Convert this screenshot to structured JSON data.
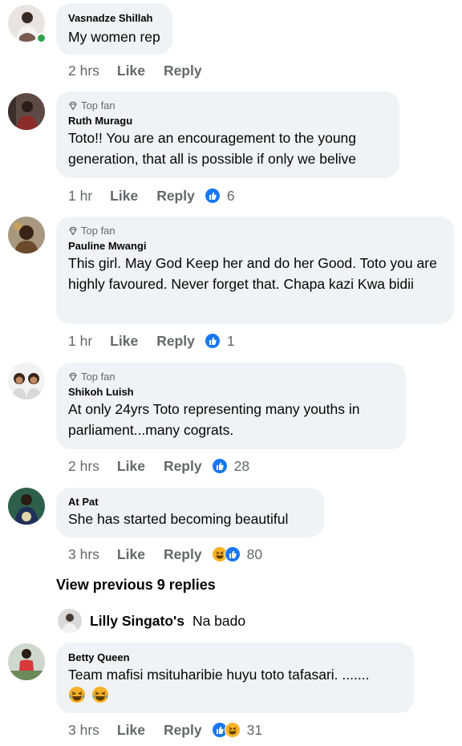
{
  "comments": [
    {
      "author": "Vasnadze Shillah",
      "badge": "",
      "text": "My women rep",
      "time": "2 hrs",
      "like_label": "Like",
      "reply_label": "Reply",
      "reactions": [],
      "reaction_count": ""
    },
    {
      "author": "Ruth Muragu",
      "badge": "Top fan",
      "text": "Toto!! You are an encouragement to the young generation, that all is possible if only we belive",
      "time": "1 hr",
      "like_label": "Like",
      "reply_label": "Reply",
      "reactions": [
        "like-icon"
      ],
      "reaction_count": "6"
    },
    {
      "author": "Pauline Mwangi",
      "badge": "Top fan",
      "text": "This girl. May God Keep her and do her Good. Toto you are highly favoured. Never forget that. Chapa kazi Kwa bidii",
      "time": "1 hr",
      "like_label": "Like",
      "reply_label": "Reply",
      "reactions": [
        "like-icon"
      ],
      "reaction_count": "1"
    },
    {
      "author": "Shikoh Luish",
      "badge": "Top fan",
      "text": "At only 24yrs Toto representing many  youths in parliament...many cograts.",
      "time": "2 hrs",
      "like_label": "Like",
      "reply_label": "Reply",
      "reactions": [
        "like-icon"
      ],
      "reaction_count": "28"
    },
    {
      "author": "At Pat",
      "badge": "",
      "text": "She has started becoming beautiful",
      "time": "3 hrs",
      "like_label": "Like",
      "reply_label": "Reply",
      "reactions": [
        "haha-icon",
        "like-icon"
      ],
      "reaction_count": "80"
    },
    {
      "author": "Betty Queen",
      "badge": "",
      "text": "Team mafisi msituharibie huyu toto tafasari. .......",
      "time": "3 hrs",
      "like_label": "Like",
      "reply_label": "Reply",
      "reactions": [
        "like-icon",
        "haha-icon"
      ],
      "reaction_count": "31"
    }
  ],
  "view_previous": "View previous 9 replies",
  "reply_preview": {
    "name": "Lilly Singato's",
    "snippet": "Na bado"
  },
  "colors": {
    "bubble": "#f0f2f5",
    "meta_text": "#65676b",
    "like_blue": "#1877f2",
    "haha_yellow": "#f7b125",
    "online_green": "#31a24c"
  }
}
